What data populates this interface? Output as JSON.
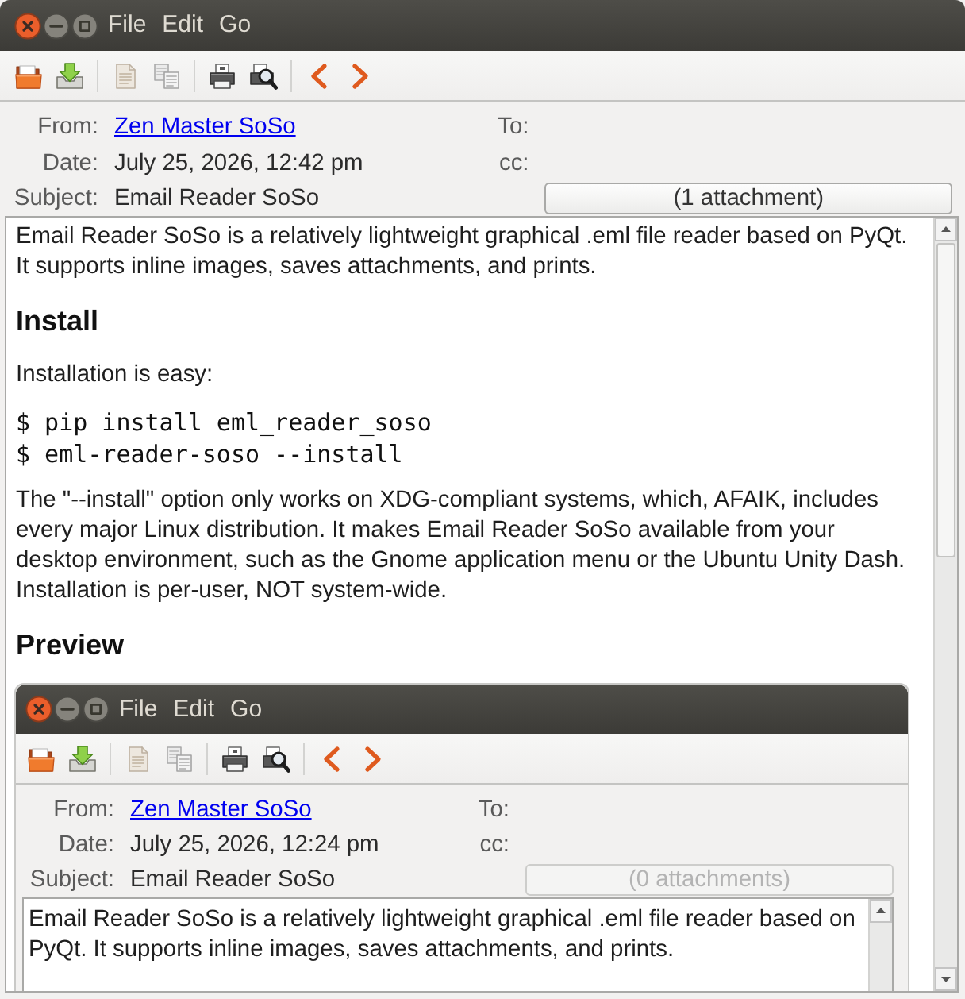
{
  "window": {
    "menu": [
      "File",
      "Edit",
      "Go"
    ]
  },
  "header": {
    "from": {
      "label": "From:",
      "value": "Zen Master SoSo"
    },
    "to": {
      "label": "To:"
    },
    "date": {
      "label": "Date:",
      "value": "July 25, 2026, 12:42 pm"
    },
    "cc": {
      "label": "cc:"
    },
    "subject": {
      "label": "Subject:",
      "value": "Email Reader SoSo"
    },
    "attachments": {
      "label": "(1 attachment)",
      "disabled": false
    }
  },
  "body": {
    "blocks": [
      {
        "kind": "paragraph",
        "text": "Email Reader SoSo is a relatively lightweight graphical .eml file reader based on PyQt. It supports inline images, saves attachments, and prints."
      },
      {
        "kind": "heading",
        "text": "Install"
      },
      {
        "kind": "paragraph",
        "text": "Installation is easy:"
      },
      {
        "kind": "code",
        "lines": [
          "$ pip install eml_reader_soso",
          "$ eml-reader-soso --install"
        ]
      },
      {
        "kind": "paragraph",
        "text": "The \"--install\" option only works on XDG-compliant systems, which, AFAIK, includes every major Linux distribution. It makes Email Reader SoSo available from your desktop environment, such as the Gnome application menu or the Ubuntu Unity Dash. Installation is per-user, NOT system-wide."
      },
      {
        "kind": "heading",
        "text": "Preview"
      },
      {
        "kind": "screenshot",
        "window": {
          "menu": [
            "File",
            "Edit",
            "Go"
          ]
        },
        "header": {
          "from": {
            "label": "From:",
            "value": "Zen Master SoSo"
          },
          "to": {
            "label": "To:"
          },
          "date": {
            "label": "Date:",
            "value": "July 25, 2026, 12:24 pm"
          },
          "cc": {
            "label": "cc:"
          },
          "subject": {
            "label": "Subject:",
            "value": "Email Reader SoSo"
          },
          "attachments": {
            "label": "(0 attachments)",
            "disabled": true
          }
        },
        "body": {
          "blocks": [
            {
              "kind": "paragraph",
              "text": "Email Reader SoSo is a relatively lightweight graphical .eml file reader based on PyQt. It supports inline images, saves attachments, and prints."
            }
          ]
        }
      }
    ]
  }
}
